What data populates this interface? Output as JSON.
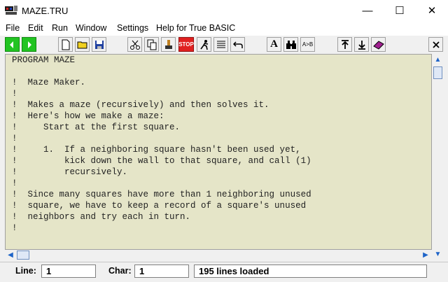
{
  "window": {
    "title": "MAZE.TRU",
    "minimize_glyph": "—",
    "maximize_glyph": "☐",
    "close_glyph": "✕"
  },
  "menu": [
    "File",
    "Edit",
    "Run",
    "Window",
    "Settings",
    "Help for True BASIC"
  ],
  "toolbar": {
    "stop_label": "STOP",
    "ab_label": "A>B",
    "font_label": "A",
    "icons": [
      "run-green-icon",
      "step-green-icon",
      "new-file-icon",
      "open-folder-icon",
      "save-disk-icon",
      "cut-scissors-icon",
      "copy-icon",
      "paste-brush-icon",
      "stop-icon",
      "runner-icon",
      "list-lines-icon",
      "undo-arrow-icon",
      "font-a-icon",
      "binoculars-icon",
      "replace-ab-icon",
      "go-top-icon",
      "go-bottom-icon",
      "book-icon",
      "close-x-icon"
    ],
    "accent_green": "#22c422",
    "stop_red": "#e02020"
  },
  "editor": {
    "background": "#e5e5c8",
    "lines": [
      "PROGRAM MAZE",
      "",
      "!  Maze Maker.",
      "!",
      "!  Makes a maze (recursively) and then solves it.",
      "!  Here's how we make a maze:",
      "!     Start at the first square.",
      "!",
      "!     1.  If a neighboring square hasn't been used yet,",
      "!         kick down the wall to that square, and call (1)",
      "!         recursively.",
      "!",
      "!  Since many squares have more than 1 neighboring unused",
      "!  square, we have to keep a record of a square's unused",
      "!  neighbors and try each in turn.",
      "!"
    ]
  },
  "status": {
    "line_label": "Line:",
    "line_value": "1",
    "char_label": "Char:",
    "char_value": "1",
    "message": "195 lines loaded"
  }
}
